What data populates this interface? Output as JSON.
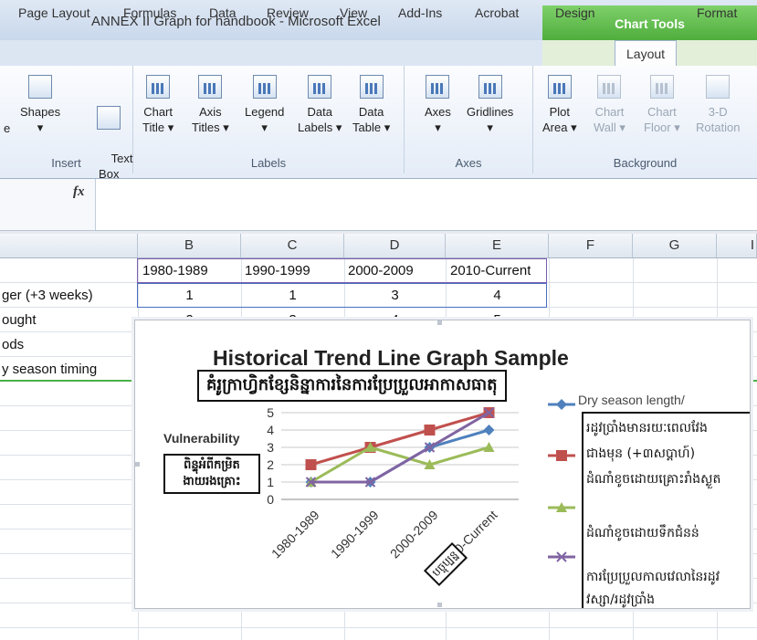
{
  "window": {
    "title": "ANNEX II Graph for handbook  -  Microsoft Excel",
    "context_tab_group": "Chart Tools"
  },
  "tabs": [
    "Page Layout",
    "Formulas",
    "Data",
    "Review",
    "View",
    "Add-Ins",
    "Acrobat",
    "Design",
    "Layout",
    "Format"
  ],
  "active_tab": "Layout",
  "ribbon": {
    "insert": {
      "label": "Insert",
      "buttons": [
        "e",
        "Shapes",
        "Text\nBox"
      ]
    },
    "labels": {
      "label": "Labels",
      "buttons": [
        "Chart\nTitle ▾",
        "Axis\nTitles ▾",
        "Legend\n▾",
        "Data\nLabels ▾",
        "Data\nTable ▾"
      ]
    },
    "axes": {
      "label": "Axes",
      "buttons": [
        "Axes\n▾",
        "Gridlines\n▾"
      ]
    },
    "background": {
      "label": "Background",
      "buttons": [
        "Plot\nArea ▾",
        "Chart\nWall ▾",
        "Chart\nFloor ▾",
        "3-D\nRotation"
      ]
    }
  },
  "formula_bar": {
    "fx": "fx",
    "value": ""
  },
  "columns": [
    "B",
    "C",
    "D",
    "E",
    "F",
    "G",
    "I"
  ],
  "sheet": {
    "header_row": [
      "1980-1989",
      "1990-1999",
      "2000-2009",
      "2010-Current"
    ],
    "rows": [
      {
        "label": "ger (+3 weeks)",
        "values": [
          "1",
          "1",
          "3",
          "4"
        ]
      },
      {
        "label": "ought",
        "values": [
          "2",
          "3",
          "4",
          "5"
        ]
      },
      {
        "label": "ods",
        "values": [
          "",
          "",
          "",
          ""
        ]
      },
      {
        "label": "y season timing",
        "values": [
          "",
          "",
          "",
          ""
        ]
      }
    ]
  },
  "chart_data": {
    "type": "line",
    "title": "Historical Trend Line Graph Sample",
    "title_khmer": "គំរូក្រាហ្វិកខ្សែនិន្នាការនៃការប្រែប្រួលអាកាសធាតុ",
    "ylabel": "Vulnerability",
    "ylabel_khmer": "ពិន្ទុអំពីកម្រិតងាយរងគ្រោះ",
    "xlabel_khmer": "បច្ចុប្បន្ន",
    "categories": [
      "1980-1989",
      "1990-1999",
      "2000-2009",
      "2010-Current"
    ],
    "ylim": [
      0,
      5
    ],
    "yticks": [
      "0",
      "1",
      "2",
      "3",
      "4",
      "5"
    ],
    "grid": true,
    "legend_position": "right",
    "series": [
      {
        "name": "Dry season length/",
        "color": "#4f81bd",
        "marker": "diamond",
        "values": [
          1,
          1,
          3,
          4
        ]
      },
      {
        "name": "",
        "color": "#c0504d",
        "marker": "square",
        "values": [
          2,
          3,
          4,
          5
        ]
      },
      {
        "name": "",
        "color": "#9bbb59",
        "marker": "triangle",
        "values": [
          1,
          3,
          2,
          3
        ]
      },
      {
        "name": "",
        "color": "#8064a2",
        "marker": "x",
        "values": [
          1,
          1,
          3,
          5
        ]
      }
    ],
    "legend_khmer": [
      "រដូវប្រាំងមានរយៈពេលវែង",
      "ជាងមុន (+៣សប្តាហ៍)",
      "ដំណាំខូចដោយគ្រោះរាំងស្ងួត",
      "ដំណាំខូចដោយទឹកជំនន់",
      "ការប្រែប្រួលកាលវេលានៃរដូវ",
      "វស្សា/រដូវប្រាំង"
    ]
  }
}
